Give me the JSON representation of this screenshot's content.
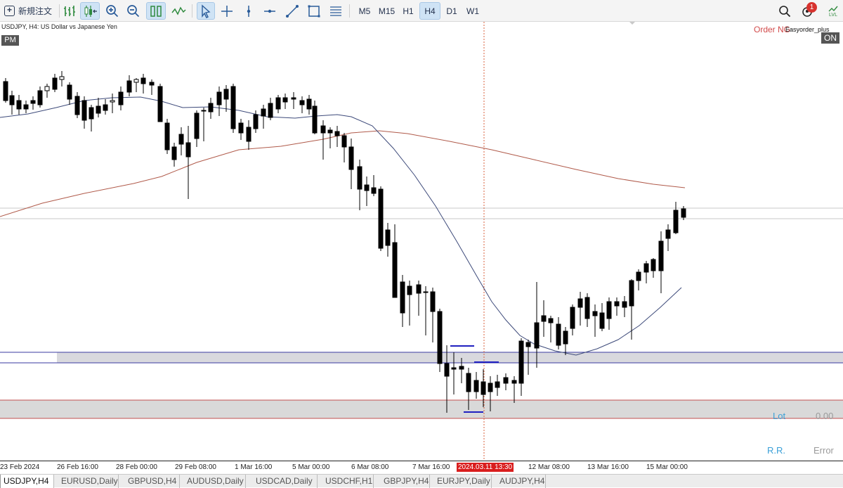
{
  "toolbar": {
    "new_order_label": "新規注文",
    "timeframes": [
      "M5",
      "M15",
      "H1",
      "H4",
      "D1",
      "W1"
    ],
    "active_timeframe": "H4",
    "notification_count": "1",
    "level_icon_label": "LVL"
  },
  "chart": {
    "symbol_info": "USDJPY, H4:  US Dollar vs Japanese Yen",
    "pm_badge": "PM",
    "order_status": "Order NG",
    "ea_name": "Easyorder_plus",
    "on_badge": "ON",
    "lot_label": "Lot",
    "lot_value": "0.00",
    "rr_label": "R.R.",
    "rr_value": "Error",
    "colors": {
      "bull_body": "#ffffff",
      "bear_body": "#000000",
      "ma_fast": "#3d4a7a",
      "ma_slow": "#b05a4a",
      "cursor": "#d9603d"
    }
  },
  "time_axis": {
    "labels": [
      "23 Feb 2024",
      "26 Feb 16:00",
      "28 Feb 00:00",
      "29 Feb 08:00",
      "1 Mar 16:00",
      "5 Mar 00:00",
      "6 Mar 08:00",
      "7 Mar 16:00",
      "12 Mar 08:00",
      "13 Mar 16:00",
      "15 Mar 00:00"
    ],
    "cursor_time": "2024.03.11 13:30"
  },
  "tabs": [
    "USDJPY,H4",
    "EURUSD,Daily",
    "GBPUSD,H4",
    "AUDUSD,Daily",
    "USDCAD,Daily",
    "USDCHF,H1",
    "GBPJPY,H4",
    "EURJPY,Daily",
    "AUDJPY,H4"
  ],
  "active_tab": "USDJPY,H4"
}
